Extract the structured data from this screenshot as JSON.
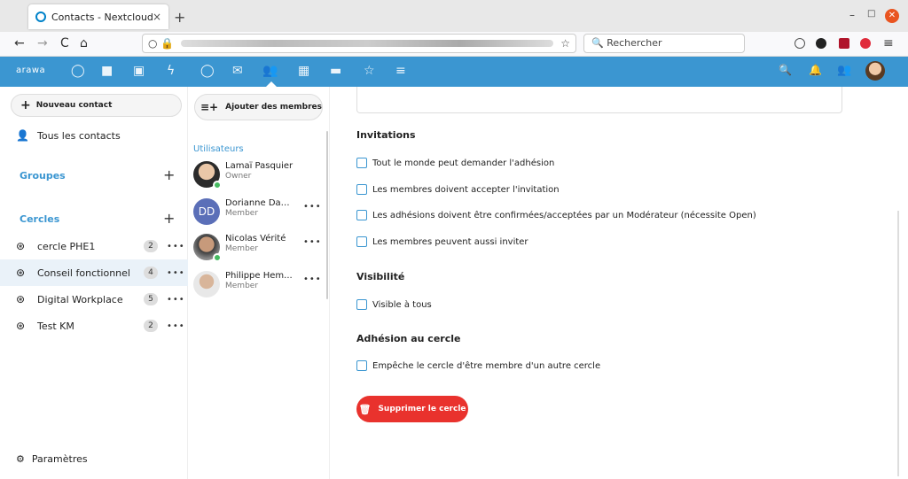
{
  "browser": {
    "tab_title": "Contacts - Nextcloud",
    "tab_close": "×",
    "new_tab": "+",
    "back": "←",
    "forward": "→",
    "reload": "C",
    "home": "⌂",
    "url_prefix": "○ 🔒",
    "bookmark": "☆",
    "search_placeholder": "Rechercher",
    "menu": "≡",
    "minimize": "–",
    "maximize": "□",
    "close": "✕"
  },
  "nc_header": {
    "brand": "arawa",
    "search_icon": "🔍",
    "notif_icon": "🔔",
    "contacts_icon": "👥"
  },
  "sidebar": {
    "new_contact": "Nouveau contact",
    "all_contacts": "Tous les contacts",
    "groups_title": "Groupes",
    "groups_add": "+",
    "circles_title": "Cercles",
    "circles_add": "+",
    "circles": [
      {
        "label": "cercle PHE1",
        "count": "2"
      },
      {
        "label": "Conseil fonctionnel",
        "count": "4"
      },
      {
        "label": "Digital Workplace",
        "count": "5"
      },
      {
        "label": "Test KM",
        "count": "2"
      }
    ],
    "more": "•••",
    "settings": "Paramètres"
  },
  "members": {
    "add_button": "Ajouter des membres",
    "section_label": "Utilisateurs",
    "list": [
      {
        "name": "Lamaï Pasquier",
        "role": "Owner"
      },
      {
        "name": "Dorianne Dam...",
        "role": "Member",
        "initials": "DD"
      },
      {
        "name": "Nicolas Vérité",
        "role": "Member"
      },
      {
        "name": "Philippe Hem...",
        "role": "Member"
      }
    ],
    "more": "•••"
  },
  "main": {
    "invitations_title": "Invitations",
    "invitations": [
      "Tout le monde peut demander l'adhésion",
      "Les membres doivent accepter l'invitation",
      "Les adhésions doivent être confirmées/acceptées par un Modérateur (nécessite Open)",
      "Les membres peuvent aussi inviter"
    ],
    "visibility_title": "Visibilité",
    "visibility_option": "Visible à tous",
    "membership_title": "Adhésion au cercle",
    "membership_option": "Empêche le cercle d'être membre d'un autre cercle",
    "delete_button": "Supprimer le cercle"
  },
  "colors": {
    "accent": "#3b96d1",
    "danger": "#e9322d",
    "online": "#46ba61",
    "selected_row": "#eaf2f9"
  }
}
